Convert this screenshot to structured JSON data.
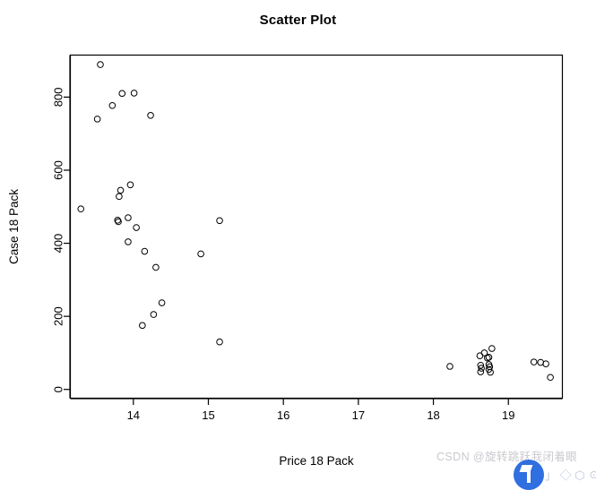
{
  "figure": {
    "title": "Scatter Plot",
    "background_color": "#ffffff",
    "foreground_color": "#000000"
  },
  "watermark": {
    "text": "CSDN @旋转跳跃我闭着眼",
    "tail_text": "」 ◇ ⬡ ☉ ⯀",
    "color": "#c9c9cf",
    "badge_color": "#2f6fe0"
  },
  "chart_data": {
    "type": "scatter",
    "title": "Scatter Plot",
    "xlabel": "Price 18 Pack",
    "ylabel": "Case 18 Pack",
    "xlim": [
      13.16,
      19.72
    ],
    "ylim": [
      -24,
      915
    ],
    "xticks": [
      14,
      15,
      16,
      17,
      18,
      19
    ],
    "xtick_labels": [
      "14",
      "15",
      "16",
      "17",
      "18",
      "19"
    ],
    "yticks": [
      0,
      200,
      400,
      600,
      800
    ],
    "ytick_labels": [
      "0",
      "200",
      "400",
      "600",
      "800"
    ],
    "grid": false,
    "legend": null,
    "marker": {
      "shape": "open-circle",
      "radius_px": 3.3,
      "stroke": "#000000",
      "stroke_width": 1,
      "fill": "none"
    },
    "frame": true,
    "points": [
      {
        "x": 13.3,
        "y": 494
      },
      {
        "x": 13.56,
        "y": 889
      },
      {
        "x": 13.52,
        "y": 740
      },
      {
        "x": 13.72,
        "y": 777
      },
      {
        "x": 13.85,
        "y": 810
      },
      {
        "x": 14.01,
        "y": 811
      },
      {
        "x": 14.23,
        "y": 750
      },
      {
        "x": 13.83,
        "y": 545
      },
      {
        "x": 13.96,
        "y": 560
      },
      {
        "x": 13.81,
        "y": 528
      },
      {
        "x": 13.79,
        "y": 463
      },
      {
        "x": 13.8,
        "y": 459
      },
      {
        "x": 13.93,
        "y": 470
      },
      {
        "x": 14.04,
        "y": 443
      },
      {
        "x": 13.93,
        "y": 404
      },
      {
        "x": 15.15,
        "y": 462
      },
      {
        "x": 14.15,
        "y": 378
      },
      {
        "x": 14.3,
        "y": 334
      },
      {
        "x": 14.9,
        "y": 371
      },
      {
        "x": 14.38,
        "y": 237
      },
      {
        "x": 14.27,
        "y": 205
      },
      {
        "x": 14.12,
        "y": 175
      },
      {
        "x": 15.15,
        "y": 130
      },
      {
        "x": 18.22,
        "y": 63
      },
      {
        "x": 18.68,
        "y": 100
      },
      {
        "x": 18.78,
        "y": 112
      },
      {
        "x": 18.62,
        "y": 92
      },
      {
        "x": 18.74,
        "y": 88
      },
      {
        "x": 18.72,
        "y": 86
      },
      {
        "x": 18.63,
        "y": 66
      },
      {
        "x": 18.64,
        "y": 58
      },
      {
        "x": 18.74,
        "y": 68
      },
      {
        "x": 18.75,
        "y": 62
      },
      {
        "x": 18.74,
        "y": 55
      },
      {
        "x": 18.76,
        "y": 47
      },
      {
        "x": 18.63,
        "y": 48
      },
      {
        "x": 19.34,
        "y": 75
      },
      {
        "x": 19.43,
        "y": 74
      },
      {
        "x": 19.5,
        "y": 70
      },
      {
        "x": 19.56,
        "y": 33
      }
    ]
  }
}
